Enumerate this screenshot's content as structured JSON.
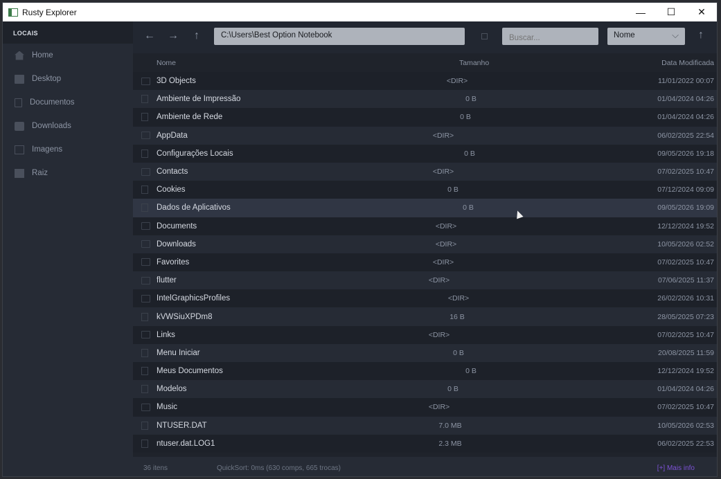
{
  "window": {
    "title": "Rusty Explorer",
    "minimize": "—",
    "maximize": "☐",
    "close": "✕"
  },
  "sidebar": {
    "section_label": "LOCAIS",
    "items": [
      {
        "label": "Home",
        "icon": "home-icon"
      },
      {
        "label": "Desktop",
        "icon": "desktop-icon"
      },
      {
        "label": "Documentos",
        "icon": "document-icon"
      },
      {
        "label": "Downloads",
        "icon": "download-icon"
      },
      {
        "label": "Imagens",
        "icon": "image-icon"
      },
      {
        "label": "Raiz",
        "icon": "root-icon"
      }
    ]
  },
  "toolbar": {
    "back": "←",
    "forward": "→",
    "up": "↑",
    "path": "C:\\Users\\Best Option Notebook",
    "search_placeholder": "Buscar...",
    "sort_value": "Nome",
    "sort_chevron": "⌵",
    "sort_direction": "↑"
  },
  "list": {
    "headers": {
      "name": "Nome",
      "size": "Tamanho",
      "date": "Data Modificada"
    },
    "rows": [
      {
        "name": "3D Objects",
        "size": "<DIR>",
        "date": "11/01/2022 00:07",
        "type": "dir"
      },
      {
        "name": "Ambiente de Impressão",
        "size": "0 B",
        "date": "01/04/2024 04:26",
        "type": "file"
      },
      {
        "name": "Ambiente de Rede",
        "size": "0 B",
        "date": "01/04/2024 04:26",
        "type": "file"
      },
      {
        "name": "AppData",
        "size": "<DIR>",
        "date": "06/02/2025 22:54",
        "type": "dir"
      },
      {
        "name": "Configurações Locais",
        "size": "0 B",
        "date": "09/05/2026 19:18",
        "type": "file"
      },
      {
        "name": "Contacts",
        "size": "<DIR>",
        "date": "07/02/2025 10:47",
        "type": "dir"
      },
      {
        "name": "Cookies",
        "size": "0 B",
        "date": "07/12/2024 09:09",
        "type": "file"
      },
      {
        "name": "Dados de Aplicativos",
        "size": "0 B",
        "date": "09/05/2026 19:09",
        "type": "file"
      },
      {
        "name": "Documents",
        "size": "<DIR>",
        "date": "12/12/2024 19:52",
        "type": "dir"
      },
      {
        "name": "Downloads",
        "size": "<DIR>",
        "date": "10/05/2026 02:52",
        "type": "dir"
      },
      {
        "name": "Favorites",
        "size": "<DIR>",
        "date": "07/02/2025 10:47",
        "type": "dir"
      },
      {
        "name": "flutter",
        "size": "<DIR>",
        "date": "07/06/2025 11:37",
        "type": "dir"
      },
      {
        "name": "IntelGraphicsProfiles",
        "size": "<DIR>",
        "date": "26/02/2026 10:31",
        "type": "dir"
      },
      {
        "name": "kVWSiuXPDm8",
        "size": "16 B",
        "date": "28/05/2025 07:23",
        "type": "file"
      },
      {
        "name": "Links",
        "size": "<DIR>",
        "date": "07/02/2025 10:47",
        "type": "dir"
      },
      {
        "name": "Menu Iniciar",
        "size": "0 B",
        "date": "20/08/2025 11:59",
        "type": "file"
      },
      {
        "name": "Meus Documentos",
        "size": "0 B",
        "date": "12/12/2024 19:52",
        "type": "file"
      },
      {
        "name": "Modelos",
        "size": "0 B",
        "date": "01/04/2024 04:26",
        "type": "file"
      },
      {
        "name": "Music",
        "size": "<DIR>",
        "date": "07/02/2025 10:47",
        "type": "dir"
      },
      {
        "name": "NTUSER.DAT",
        "size": "7.0 MB",
        "date": "10/05/2026 02:53",
        "type": "file"
      },
      {
        "name": "ntuser.dat.LOG1",
        "size": "2.3 MB",
        "date": "06/02/2025 22:53",
        "type": "file"
      }
    ]
  },
  "status": {
    "count": "36 itens",
    "perf": "QuickSort: 0ms (630 comps, 665 trocas)",
    "more": "[+] Mais info"
  }
}
